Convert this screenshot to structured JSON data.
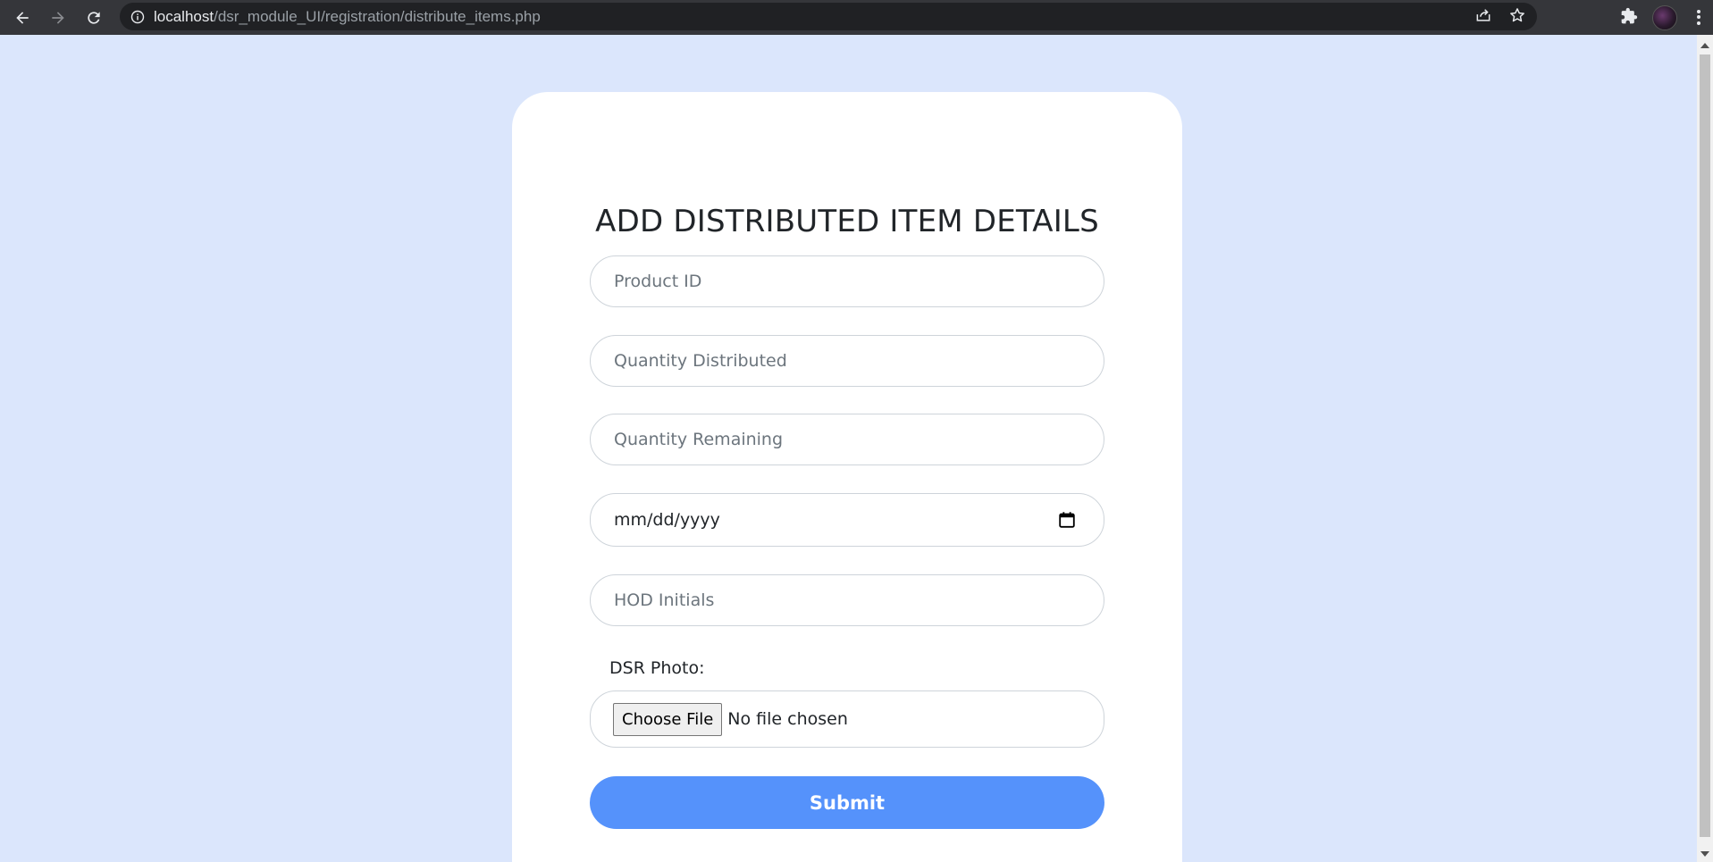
{
  "browser": {
    "url_host": "localhost",
    "url_path": "/dsr_module_UI/registration/distribute_items.php"
  },
  "form": {
    "title": "ADD DISTRIBUTED ITEM DETAILS",
    "product_id_placeholder": "Product ID",
    "quantity_distributed_placeholder": "Quantity Distributed",
    "quantity_remaining_placeholder": "Quantity Remaining",
    "date_placeholder": "mm/dd/yyyy",
    "hod_initials_placeholder": "HOD Initials",
    "photo_label": "DSR Photo:",
    "choose_file_label": "Choose File",
    "no_file_text": "No file chosen",
    "submit_label": "Submit"
  },
  "colors": {
    "page_bg": "#dbe6fc",
    "card_bg": "#ffffff",
    "submit_bg": "#5592fb",
    "chrome_bg": "#35363a"
  },
  "icons": {
    "back": "back-arrow-icon",
    "forward": "forward-arrow-icon",
    "reload": "reload-icon",
    "info": "info-icon",
    "share": "share-icon",
    "bookmark": "star-icon",
    "extensions": "puzzle-icon",
    "menu": "kebab-menu-icon",
    "calendar": "calendar-icon"
  }
}
